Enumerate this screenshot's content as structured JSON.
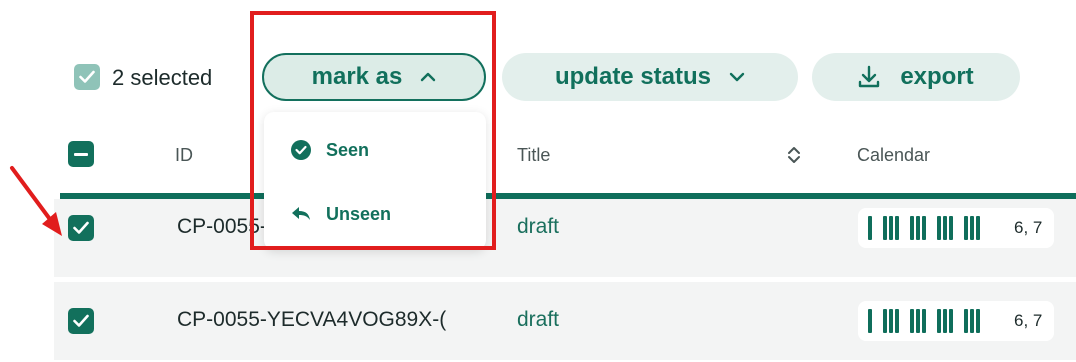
{
  "toolbar": {
    "selected_label": "2 selected",
    "mark_as_label": "mark as",
    "update_status_label": "update status",
    "export_label": "export"
  },
  "dropdown": {
    "items": [
      {
        "label": "Seen",
        "icon": "check-circle-icon"
      },
      {
        "label": "Unseen",
        "icon": "reply-arrow-icon"
      }
    ]
  },
  "table": {
    "columns": [
      "ID",
      "Title",
      "Calendar"
    ],
    "rows": [
      {
        "id": "CP-0055-YECVA4VOG89X-(",
        "title": "draft",
        "calendar": "6, 7",
        "checked": true
      },
      {
        "id": "CP-0055-YECVA4VOG89X-(",
        "title": "draft",
        "calendar": "6, 7",
        "checked": true
      }
    ]
  },
  "colors": {
    "accent": "#0f6e5b",
    "annotation": "#e11d1d"
  }
}
